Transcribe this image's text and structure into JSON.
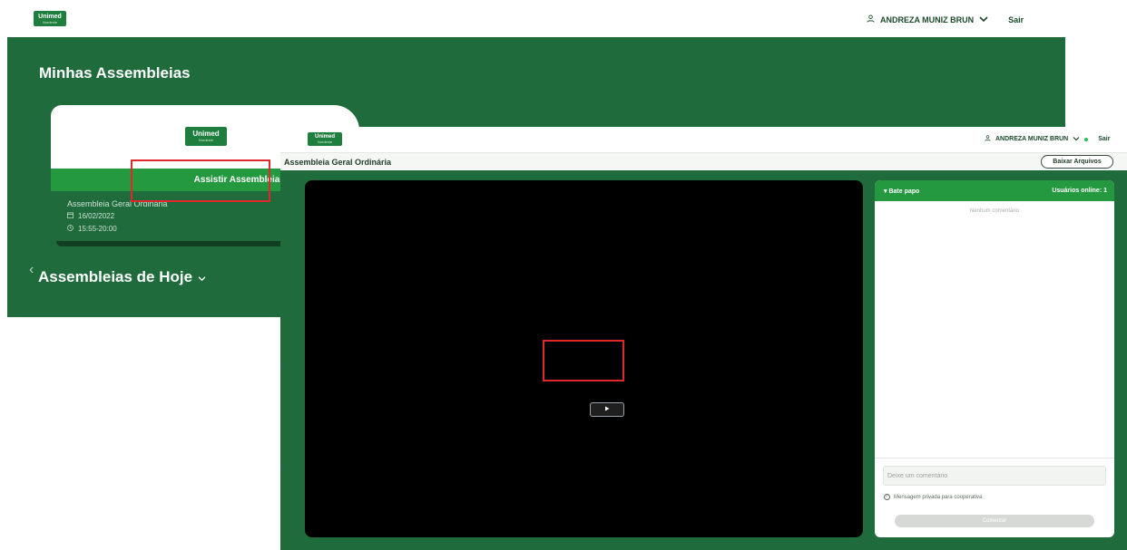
{
  "brand": {
    "logo_text": "Unimed",
    "logo_sub": "Nordeste"
  },
  "window1": {
    "user_name": "ANDREZA MUNIZ BRUN",
    "logout": "Sair",
    "page_title": "Minhas Assembleias",
    "card": {
      "button": "Assistir Assembleia",
      "title": "Assembleia Geral Ordinária",
      "date": "16/02/2022",
      "time": "15:55-20:00"
    },
    "section_title": "Assembleias de Hoje"
  },
  "window2": {
    "user_name": "ANDREZA MUNIZ BRUN",
    "logout": "Sair",
    "page_title": "Assembleia Geral Ordinária",
    "download_button": "Baixar Arquivos",
    "chat": {
      "title": "Bate papo",
      "online": "Usuários online: 1",
      "empty": "Nenhum comentário",
      "input_placeholder": "Deixe um comentário",
      "private_label": "Mensagem privada para cooperativa",
      "submit": "Comentar"
    }
  },
  "icons": [
    "user-icon",
    "chevron-down-icon",
    "calendar-icon",
    "clock-icon",
    "play-icon",
    "chevron-left-icon",
    "caret-down-icon",
    "check-circle-icon",
    "status-dot-icon"
  ],
  "colors": {
    "brand_green": "#1f6b3c",
    "accent_green": "#24993f",
    "highlight_red": "#e0282c"
  }
}
